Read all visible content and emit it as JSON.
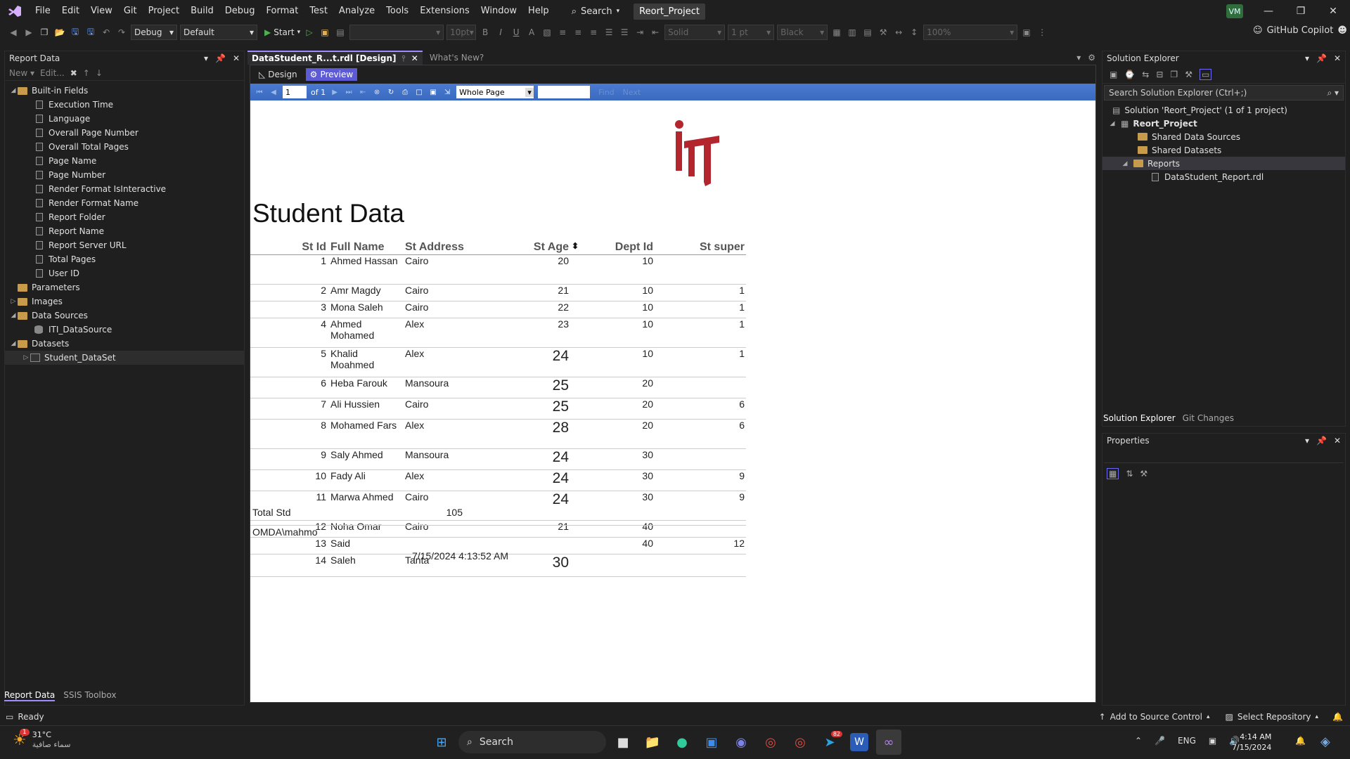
{
  "menu": {
    "items": [
      "File",
      "Edit",
      "View",
      "Git",
      "Project",
      "Build",
      "Debug",
      "Format",
      "Test",
      "Analyze",
      "Tools",
      "Extensions",
      "Window",
      "Help"
    ],
    "search_label": "Search",
    "project_name": "Reort_Project",
    "avatar": "VM"
  },
  "toolbar": {
    "config": "Debug",
    "platform": "Default",
    "start_label": "Start",
    "font_size": "10pt",
    "border_style": "Solid",
    "border_width": "1 pt",
    "color": "Black",
    "zoom": "100%",
    "copilot_label": "GitHub Copilot"
  },
  "report_data_panel": {
    "title": "Report Data",
    "new_label": "New",
    "edit_label": "Edit...",
    "built_in_label": "Built-in Fields",
    "built_in_fields": [
      "Execution Time",
      "Language",
      "Overall Page Number",
      "Overall Total Pages",
      "Page Name",
      "Page Number",
      "Render Format IsInteractive",
      "Render Format Name",
      "Report Folder",
      "Report Name",
      "Report Server URL",
      "Total Pages",
      "User ID"
    ],
    "parameters": "Parameters",
    "images": "Images",
    "data_sources": "Data Sources",
    "datasource_item": "ITI_DataSource",
    "datasets": "Datasets",
    "dataset_item": "Student_DataSet",
    "tab_report_data": "Report Data",
    "tab_ssis": "SSIS Toolbox"
  },
  "editor": {
    "active_tab": "DataStudent_R...t.rdl [Design]",
    "second_tab": "What's New?",
    "design_label": "Design",
    "preview_label": "Preview",
    "page_current": "1",
    "page_of": "of 1",
    "zoom_mode": "Whole Page",
    "find_label": "Find",
    "next_label": "Next"
  },
  "report": {
    "title": "Student Data",
    "columns": [
      "St Id",
      "Full Name",
      "St Address",
      "St Age",
      "Dept Id",
      "St super"
    ],
    "rows": [
      {
        "id": "1",
        "name": "Ahmed Hassan",
        "address": "Cairo",
        "age": "20",
        "age_big": false,
        "dept": "10",
        "super": ""
      },
      {
        "id": "2",
        "name": "Amr Magdy",
        "address": "Cairo",
        "age": "21",
        "age_big": false,
        "dept": "10",
        "super": "1"
      },
      {
        "id": "3",
        "name": "Mona Saleh",
        "address": "Cairo",
        "age": "22",
        "age_big": false,
        "dept": "10",
        "super": "1"
      },
      {
        "id": "4",
        "name": "Ahmed Mohamed",
        "address": "Alex",
        "age": "23",
        "age_big": false,
        "dept": "10",
        "super": "1"
      },
      {
        "id": "5",
        "name": "Khalid Moahmed",
        "address": "Alex",
        "age": "24",
        "age_big": true,
        "dept": "10",
        "super": "1"
      },
      {
        "id": "6",
        "name": "Heba Farouk",
        "address": "Mansoura",
        "age": "25",
        "age_big": true,
        "dept": "20",
        "super": ""
      },
      {
        "id": "7",
        "name": "Ali Hussien",
        "address": "Cairo",
        "age": "25",
        "age_big": true,
        "dept": "20",
        "super": "6"
      },
      {
        "id": "8",
        "name": "Mohamed Fars",
        "address": "Alex",
        "age": "28",
        "age_big": true,
        "dept": "20",
        "super": "6"
      },
      {
        "id": "9",
        "name": "Saly Ahmed",
        "address": "Mansoura",
        "age": "24",
        "age_big": true,
        "dept": "30",
        "super": ""
      },
      {
        "id": "10",
        "name": "Fady Ali",
        "address": "Alex",
        "age": "24",
        "age_big": true,
        "dept": "30",
        "super": "9"
      },
      {
        "id": "11",
        "name": "Marwa Ahmed",
        "address": "Cairo",
        "age": "24",
        "age_big": true,
        "dept": "30",
        "super": "9"
      },
      {
        "id": "12",
        "name": "Noha Omar",
        "address": "Cairo",
        "age": "21",
        "age_big": false,
        "dept": "40",
        "super": ""
      },
      {
        "id": "13",
        "name": "Said",
        "address": "",
        "age": "",
        "age_big": false,
        "dept": "40",
        "super": "12"
      },
      {
        "id": "14",
        "name": " Saleh",
        "address": "Tanta",
        "age": "30",
        "age_big": true,
        "dept": "",
        "super": ""
      }
    ],
    "total_label": "Total Std",
    "total_value": "105",
    "user": "OMDA\\mahmo",
    "datetime": "7/15/2024 4:13:52 AM",
    "logo_color": "#b3262e"
  },
  "solution_explorer": {
    "title": "Solution Explorer",
    "search_placeholder": "Search Solution Explorer (Ctrl+;)",
    "solution": "Solution 'Reort_Project' (1 of 1 project)",
    "project": "Reort_Project",
    "shared_ds": "Shared Data Sources",
    "shared_datasets": "Shared Datasets",
    "reports": "Reports",
    "report_file": "DataStudent_Report.rdl",
    "tab_solution": "Solution Explorer",
    "tab_git": "Git Changes"
  },
  "properties": {
    "title": "Properties"
  },
  "status": {
    "ready": "Ready",
    "source_control": "Add to Source Control",
    "repository": "Select Repository"
  },
  "taskbar": {
    "weather_temp": "31°C",
    "weather_desc": "سماء صافية",
    "weather_badge": "1",
    "search_label": "Search",
    "language": "ENG",
    "time": "4:14 AM",
    "date": "7/15/2024",
    "telegram_badge": "82"
  },
  "colors": {
    "accent": "#9b8cff",
    "preview_tab": "#5d5bd4",
    "viewer_toolbar": "#3a6ac0"
  }
}
